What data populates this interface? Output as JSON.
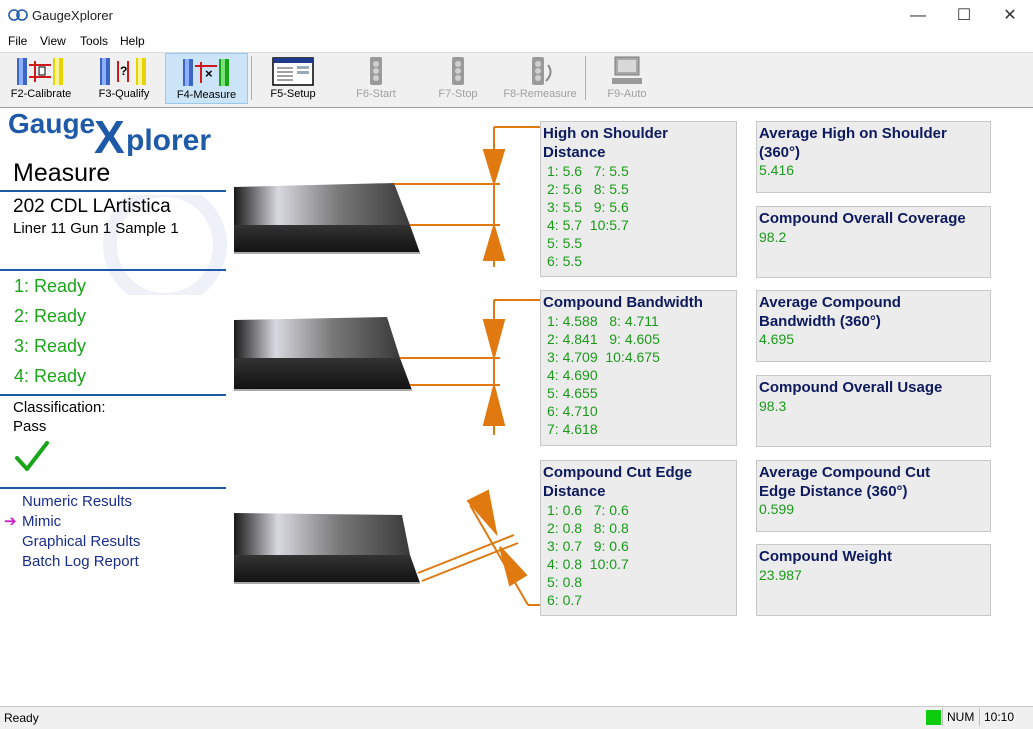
{
  "window": {
    "title": "GaugeXplorer",
    "minimize": "—",
    "maximize": "☐",
    "close": "✕"
  },
  "menu": [
    "File",
    "View",
    "Tools",
    "Help"
  ],
  "toolbar": {
    "calibrate": "F2-Calibrate",
    "qualify": "F3-Qualify",
    "measure": "F4-Measure",
    "setup": "F5-Setup",
    "start": "F6-Start",
    "stop": "F7-Stop",
    "remeasure": "F8-Remeasure",
    "auto": "F9-Auto"
  },
  "logo": {
    "word1": "Gauge",
    "word2": "X",
    "word3": "plorer"
  },
  "left": {
    "page_title": "Measure",
    "batch_title": "202 CDL LArtistica",
    "batch_sub": "Liner 11 Gun 1 Sample 1",
    "ready": [
      "1: Ready",
      "2: Ready",
      "3: Ready",
      "4: Ready"
    ],
    "classification_label": "Classification:",
    "classification_value": "Pass",
    "nav": [
      "Numeric Results",
      "Mimic",
      "Graphical Results",
      "Batch Log Report"
    ],
    "nav_arrow": "➔"
  },
  "results": {
    "high_shoulder": {
      "title_l1": "High on Shoulder",
      "title_l2": "Distance",
      "rows": [
        "1: 5.6   7: 5.5",
        "2: 5.6   8: 5.5",
        "3: 5.5   9: 5.6",
        "4: 5.7  10:5.7",
        "5: 5.5",
        "6: 5.5"
      ]
    },
    "bandwidth": {
      "title_l1": "Compound Bandwidth",
      "rows": [
        "1: 4.588   8: 4.711",
        "2: 4.841   9: 4.605",
        "3: 4.709  10:4.675",
        "4: 4.690",
        "5: 4.655",
        "6: 4.710",
        "7: 4.618"
      ]
    },
    "cut_edge": {
      "title_l1": "Compound Cut Edge",
      "title_l2": "Distance",
      "rows": [
        "1: 0.6   7: 0.6",
        "2: 0.8   8: 0.8",
        "3: 0.7   9: 0.6",
        "4: 0.8  10:0.7",
        "5: 0.8",
        "6: 0.7"
      ]
    },
    "avg_high_shoulder": {
      "title_l1": "Average High on Shoulder",
      "title_l2": "(360°)",
      "value": "5.416"
    },
    "overall_coverage": {
      "title_l1": "Compound Overall Coverage",
      "value": "98.2"
    },
    "avg_bandwidth": {
      "title_l1": "Average Compound",
      "title_l2": "Bandwidth (360°)",
      "value": "4.695"
    },
    "overall_usage": {
      "title_l1": "Compound Overall Usage",
      "value": "98.3"
    },
    "avg_cut_edge": {
      "title_l1": "Average Compound Cut",
      "title_l2": "Edge Distance (360°)",
      "value": "0.599"
    },
    "weight": {
      "title_l1": "Compound Weight",
      "value": "23.987"
    }
  },
  "status": {
    "text": "Ready",
    "num": "NUM",
    "time": "10:10"
  },
  "colors": {
    "accent_blue": "#1e5aa8",
    "ready_green": "#1aa51a",
    "dimension_orange": "#e07a10",
    "box_title": "#0d1a5e"
  }
}
